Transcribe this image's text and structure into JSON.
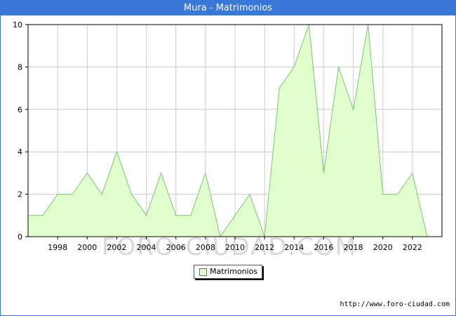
{
  "header": {
    "title": "Mura - Matrimonios"
  },
  "footer": {
    "url": "http://www.foro-ciudad.com"
  },
  "watermark": "FORO-CIUDAD.COM",
  "chart_data": {
    "type": "area",
    "title": "Mura - Matrimonios",
    "xlabel": "",
    "ylabel": "",
    "x": [
      1996,
      1997,
      1998,
      1999,
      2000,
      2001,
      2002,
      2003,
      2004,
      2005,
      2006,
      2007,
      2008,
      2009,
      2010,
      2011,
      2012,
      2013,
      2014,
      2015,
      2016,
      2017,
      2018,
      2019,
      2020,
      2021,
      2022,
      2023
    ],
    "series": [
      {
        "name": "Matrimonios",
        "values": [
          1,
          1,
          2,
          2,
          3,
          2,
          4,
          2,
          1,
          3,
          1,
          1,
          3,
          0,
          1,
          2,
          0,
          7,
          8,
          10,
          3,
          8,
          6,
          10,
          2,
          2,
          3,
          0
        ]
      }
    ],
    "xlim": [
      1996,
      2024
    ],
    "ylim": [
      0,
      10
    ],
    "x_ticks": [
      1998,
      2000,
      2002,
      2004,
      2006,
      2008,
      2010,
      2012,
      2014,
      2016,
      2018,
      2020,
      2022
    ],
    "y_ticks": [
      0,
      2,
      4,
      6,
      8,
      10
    ],
    "grid": true,
    "legend": {
      "position": "bottom-center",
      "entries": [
        "Matrimonios"
      ]
    },
    "colors": {
      "fill": "#e0ffcc",
      "line": "#7cc47c",
      "grid": "#cccccc",
      "title_bar": "#3a78d8"
    }
  }
}
